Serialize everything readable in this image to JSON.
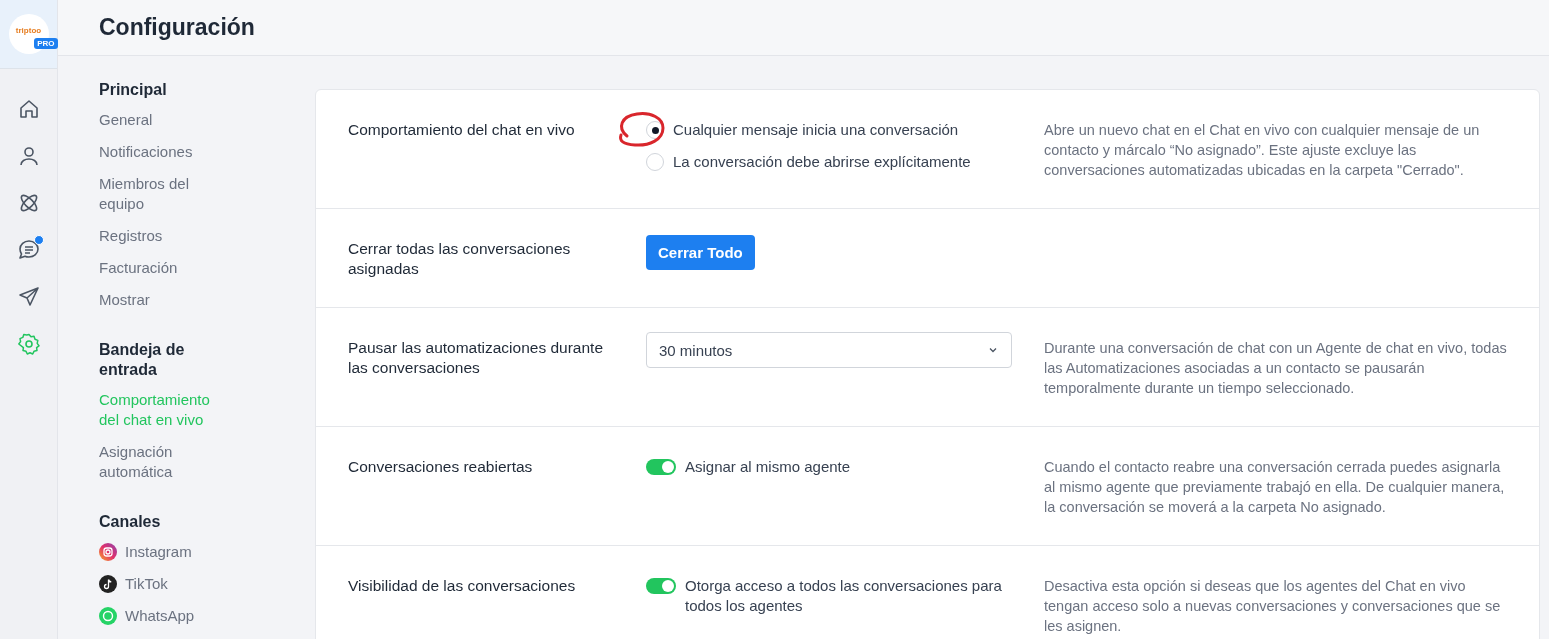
{
  "logo": {
    "text": "triptoo",
    "badge": "PRO"
  },
  "rail": [
    {
      "kind": "home",
      "selected": false,
      "notification": false
    },
    {
      "kind": "person",
      "selected": false,
      "notification": false
    },
    {
      "kind": "atom",
      "selected": false,
      "notification": false
    },
    {
      "kind": "chat",
      "selected": false,
      "notification": true
    },
    {
      "kind": "send",
      "selected": false,
      "notification": false
    },
    {
      "kind": "settings",
      "selected": true,
      "notification": false
    }
  ],
  "header": {
    "title": "Configuración"
  },
  "nav": [
    {
      "title": "Principal",
      "items": [
        {
          "label": "General",
          "selected": false
        },
        {
          "label": "Notificaciones",
          "selected": false
        },
        {
          "label": "Miembros del equipo",
          "selected": false
        },
        {
          "label": "Registros",
          "selected": false
        },
        {
          "label": "Facturación",
          "selected": false
        },
        {
          "label": "Mostrar",
          "selected": false
        }
      ]
    },
    {
      "title": "Bandeja de entrada",
      "items": [
        {
          "label": "Comportamiento del chat en vivo",
          "selected": true
        },
        {
          "label": "Asignación automática",
          "selected": false
        }
      ]
    },
    {
      "title": "Canales",
      "items": [
        {
          "label": "Instagram",
          "kind": "instagram",
          "selected": false
        },
        {
          "label": "TikTok",
          "kind": "tiktok",
          "selected": false
        },
        {
          "label": "WhatsApp",
          "kind": "whatsapp",
          "selected": false
        }
      ]
    }
  ],
  "settings": [
    {
      "kind": "radio",
      "label": "Comportamiento del chat en vivo",
      "options": [
        {
          "label": "Cualquier mensaje inicia una conversación",
          "selected": true
        },
        {
          "label": "La conversación debe abrirse explícitamente",
          "selected": false
        }
      ],
      "description": "Abre un nuevo chat en el Chat en vivo con cualquier mensaje de un contacto y márcalo “No asignado”. Este ajuste excluye las conversaciones automatizadas ubicadas en la carpeta \"Cerrado\"."
    },
    {
      "kind": "button",
      "label": "Cerrar todas las conversaciones asignadas",
      "button": "Cerrar Todo"
    },
    {
      "kind": "select",
      "label": "Pausar las automatizaciones durante las conversaciones",
      "value": "30 minutos",
      "description": "Durante una conversación de chat con un Agente de chat en vivo, todas las Automatizaciones asociadas a un contacto se pausarán temporalmente durante un tiempo seleccionado."
    },
    {
      "kind": "toggle",
      "label": "Conversaciones reabiertas",
      "on": true,
      "text": "Asignar al mismo agente",
      "description": "Cuando el contacto reabre una conversación cerrada puedes asignarla al mismo agente que previamente trabajó en ella. De cualquier manera, la conversación se moverá a la carpeta No asignado."
    },
    {
      "kind": "toggle",
      "label": "Visibilidad de las conversaciones",
      "on": true,
      "text": "Otorga acceso a todos las conversaciones para todos los agentes",
      "description": "Desactiva esta opción si deseas que los agentes del Chat en vivo tengan acceso solo a nuevas conversaciones y conversaciones que se les asignen."
    }
  ]
}
